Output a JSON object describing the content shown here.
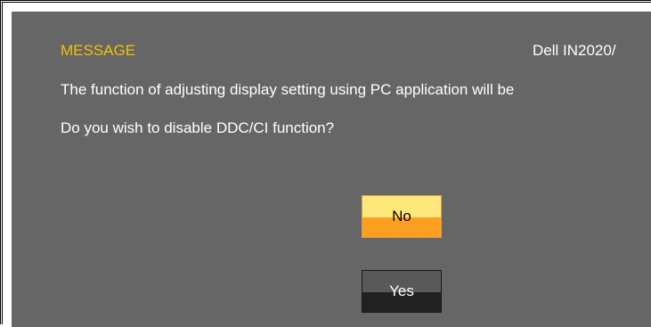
{
  "dialog": {
    "title": "MESSAGE",
    "model": "Dell IN2020/",
    "message_line1": "The function of adjusting display setting using PC application will be",
    "message_line2": "Do you wish to disable DDC/CI function?"
  },
  "buttons": {
    "no_label": "No",
    "yes_label": "Yes"
  },
  "colors": {
    "osd_background": "#666666",
    "title": "#f2c200",
    "text": "#ffffff",
    "no_button_top": "#ffe77a",
    "no_button_bottom": "#ff9f22",
    "yes_button_top": "#595959",
    "yes_button_bottom": "#222222"
  }
}
